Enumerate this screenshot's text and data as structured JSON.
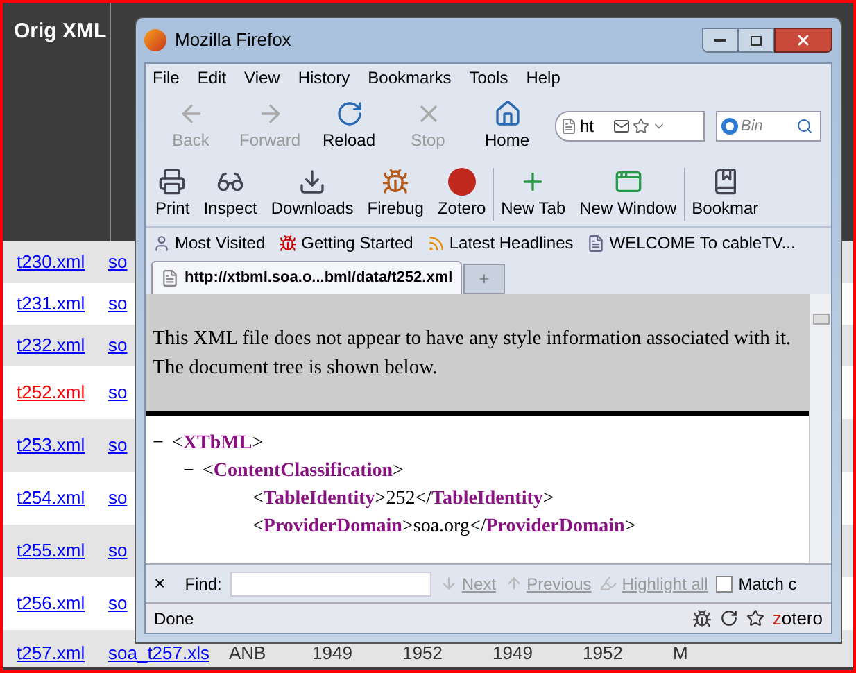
{
  "background_table": {
    "header": "Orig XML",
    "rows": [
      {
        "file": "t230.xml",
        "col2": "so",
        "visited": false
      },
      {
        "file": "t231.xml",
        "col2": "so",
        "visited": false
      },
      {
        "file": "t232.xml",
        "col2": "so",
        "visited": false
      },
      {
        "file": "t252.xml",
        "col2": "so",
        "visited": true
      },
      {
        "file": "t253.xml",
        "col2": "so",
        "visited": false
      },
      {
        "file": "t254.xml",
        "col2": "so",
        "visited": false
      },
      {
        "file": "t255.xml",
        "col2": "so",
        "visited": false
      },
      {
        "file": "t256.xml",
        "col2": "so",
        "visited": false
      },
      {
        "file": "t257.xml",
        "col2": "soa_t257.xls",
        "visited": false,
        "cells": [
          "ANB",
          "1949",
          "1952",
          "1949",
          "1952",
          "M"
        ]
      }
    ]
  },
  "window": {
    "title": "Mozilla Firefox",
    "menu": [
      "File",
      "Edit",
      "View",
      "History",
      "Bookmarks",
      "Tools",
      "Help"
    ],
    "nav_buttons": [
      {
        "kind": "back",
        "label": "Back",
        "disabled": true
      },
      {
        "kind": "forward",
        "label": "Forward",
        "disabled": true
      },
      {
        "kind": "reload",
        "label": "Reload",
        "disabled": false
      },
      {
        "kind": "stop",
        "label": "Stop",
        "disabled": true
      },
      {
        "kind": "home",
        "label": "Home",
        "disabled": false
      }
    ],
    "address": {
      "value": "ht"
    },
    "search": {
      "placeholder": "Bin"
    },
    "tools": [
      {
        "kind": "print",
        "label": "Print"
      },
      {
        "kind": "inspect",
        "label": "Inspect"
      },
      {
        "kind": "downloads",
        "label": "Downloads"
      },
      {
        "kind": "firebug",
        "label": "Firebug"
      },
      {
        "kind": "zotero",
        "label": "Zotero"
      },
      {
        "kind": "newtab",
        "label": "New Tab"
      },
      {
        "kind": "newwindow",
        "label": "New Window"
      },
      {
        "kind": "bookmarks",
        "label": "Bookmar"
      }
    ],
    "bookmarks": [
      {
        "kind": "visited",
        "label": "Most Visited"
      },
      {
        "kind": "started",
        "label": "Getting Started"
      },
      {
        "kind": "rss",
        "label": "Latest Headlines"
      },
      {
        "kind": "page",
        "label": "WELCOME To cableTV..."
      }
    ],
    "tabs": [
      {
        "label": "http://xtbml.soa.o...bml/data/t252.xml",
        "selected": true
      }
    ],
    "notice": "This XML file does not appear to have any style information associated with it. The document tree is shown below.",
    "tree": [
      {
        "toggle": "−",
        "text": "<**XTbML**>",
        "children": [
          {
            "toggle": "−",
            "text": "<**ContentClassification**>",
            "children": [
              {
                "text": "<**TableIdentity**>252</**TableIdentity**>"
              },
              {
                "text": "<**ProviderDomain**>soa.org</**ProviderDomain**>"
              }
            ]
          }
        ]
      }
    ],
    "find_bar": {
      "close": "×",
      "label": "Find:",
      "buttons": [
        {
          "kind": "next",
          "label": "Next"
        },
        {
          "kind": "previous",
          "label": "Previous"
        },
        {
          "kind": "highlight",
          "label": "Highlight all"
        }
      ],
      "match_case": {
        "label": "Match c",
        "checked": false
      }
    },
    "status": {
      "text": "Done",
      "zotero": "zotero"
    }
  }
}
